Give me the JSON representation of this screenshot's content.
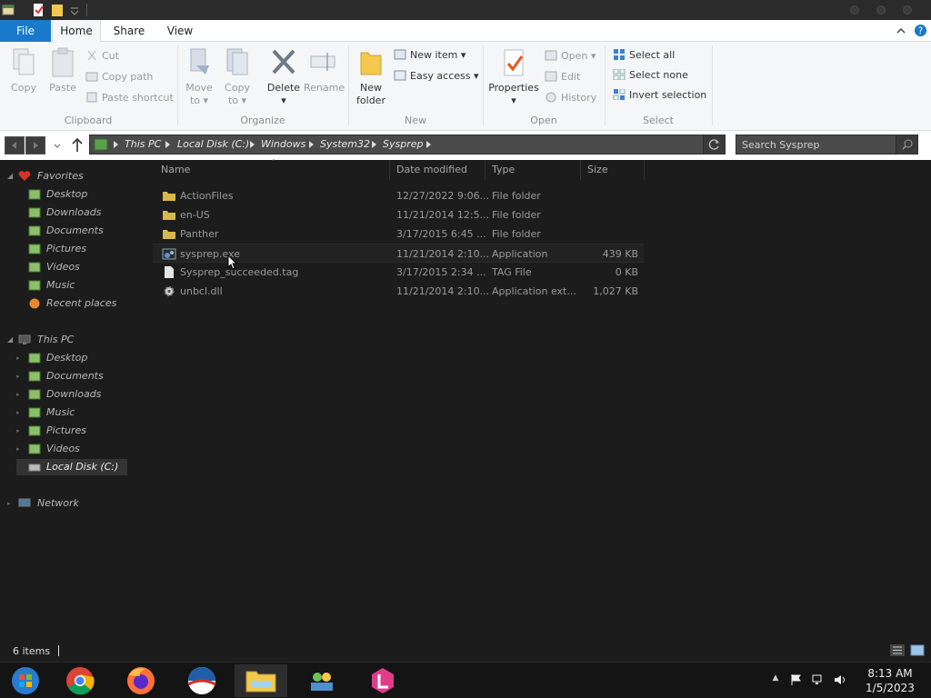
{
  "ribbon_tabs": {
    "file": "File",
    "home": "Home",
    "share": "Share",
    "view": "View"
  },
  "clipboard": {
    "copy": "Copy",
    "paste": "Paste",
    "cut": "Cut",
    "copy_path": "Copy path",
    "paste_shortcut": "Paste shortcut",
    "label": "Clipboard"
  },
  "organize": {
    "move_to_1": "Move",
    "move_to_2": "to",
    "copy_to_1": "Copy",
    "copy_to_2": "to",
    "delete": "Delete",
    "rename": "Rename",
    "label": "Organize"
  },
  "new_group": {
    "new_folder_1": "New",
    "new_folder_2": "folder",
    "new_item": "New item",
    "easy_access": "Easy access",
    "label": "New"
  },
  "open_group": {
    "properties": "Properties",
    "open": "Open",
    "edit": "Edit",
    "history": "History",
    "label": "Open"
  },
  "select_group": {
    "select_all": "Select all",
    "select_none": "Select none",
    "invert": "Invert selection",
    "label": "Select"
  },
  "address": {
    "crumbs": [
      "This PC",
      "Local Disk (C:)",
      "Windows",
      "System32",
      "Sysprep"
    ],
    "search_placeholder": "Search Sysprep"
  },
  "navpane": {
    "favorites": "Favorites",
    "fav_items": [
      "Desktop",
      "Downloads",
      "Documents",
      "Pictures",
      "Videos",
      "Music",
      "Recent places"
    ],
    "this_pc": "This PC",
    "pc_items": [
      "Desktop",
      "Documents",
      "Downloads",
      "Music",
      "Pictures",
      "Videos",
      "Local Disk (C:)"
    ],
    "network": "Network"
  },
  "columns": {
    "name": "Name",
    "date": "Date modified",
    "type": "Type",
    "size": "Size"
  },
  "files": [
    {
      "name": "ActionFiles",
      "date": "12/27/2022 9:06...",
      "type": "File folder",
      "size": "",
      "icon": "folder-icon"
    },
    {
      "name": "en-US",
      "date": "11/21/2014 12:5...",
      "type": "File folder",
      "size": "",
      "icon": "folder-icon"
    },
    {
      "name": "Panther",
      "date": "3/17/2015 6:45 ...",
      "type": "File folder",
      "size": "",
      "icon": "folder-icon"
    },
    {
      "name": "sysprep.exe",
      "date": "11/21/2014 2:10...",
      "type": "Application",
      "size": "439 KB",
      "icon": "application-icon"
    },
    {
      "name": "Sysprep_succeeded.tag",
      "date": "3/17/2015 2:34 ...",
      "type": "TAG File",
      "size": "0 KB",
      "icon": "document-icon"
    },
    {
      "name": "unbcl.dll",
      "date": "11/21/2014 2:10...",
      "type": "Application ext...",
      "size": "1,027 KB",
      "icon": "gear-icon"
    }
  ],
  "status": {
    "item_count": "6 items"
  },
  "clock": {
    "time": "8:13 AM",
    "date": "1/5/2023"
  },
  "colors": {
    "file_tab": "#1979ca",
    "folder": "#d9b84a",
    "background": "#1c1c1c"
  }
}
